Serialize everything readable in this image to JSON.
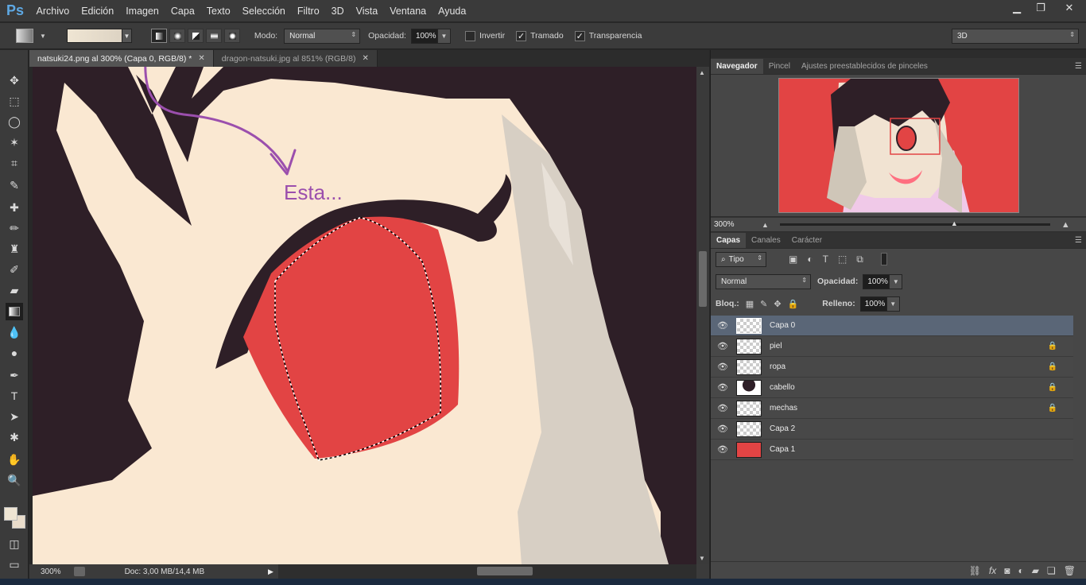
{
  "app": {
    "logo": "Ps"
  },
  "menu": [
    "Archivo",
    "Edición",
    "Imagen",
    "Capa",
    "Texto",
    "Selección",
    "Filtro",
    "3D",
    "Vista",
    "Ventana",
    "Ayuda"
  ],
  "window_controls": {
    "minimize": "▁",
    "restore": "❐",
    "close": "✕"
  },
  "options": {
    "mode_label": "Modo:",
    "mode_value": "Normal",
    "opacity_label": "Opacidad:",
    "opacity_value": "100%",
    "invert_label": "Invertir",
    "invert_checked": false,
    "dither_label": "Tramado",
    "dither_checked": true,
    "transparency_label": "Transparencia",
    "transparency_checked": true,
    "workspace_value": "3D"
  },
  "tabs": [
    {
      "label": "natsuki24.png al 300% (Capa 0, RGB/8) *",
      "close": "✕"
    },
    {
      "label": "dragon-natsuki.jpg al 851% (RGB/8)",
      "close": "✕"
    }
  ],
  "annotation": {
    "text": "Esta...",
    "color": "#9b4fad"
  },
  "status": {
    "zoom": "300%",
    "doc": "Doc: 3,00 MB/14,4 MB"
  },
  "panels": {
    "top_tabs": [
      "Navegador",
      "Pincel",
      "Ajustes preestablecidos de pinceles"
    ],
    "nav_zoom": "300%",
    "layer_tabs": [
      "Capas",
      "Canales",
      "Carácter"
    ],
    "filter_kind": "Tipo",
    "blend_mode": "Normal",
    "opacity_label": "Opacidad:",
    "opacity_value": "100%",
    "lock_label": "Bloq.:",
    "fill_label": "Relleno:",
    "fill_value": "100%"
  },
  "layers": [
    {
      "name": "Capa 0",
      "locked": false,
      "selected": true
    },
    {
      "name": "piel",
      "locked": true,
      "selected": false
    },
    {
      "name": "ropa",
      "locked": true,
      "selected": false
    },
    {
      "name": "cabello",
      "locked": true,
      "selected": false
    },
    {
      "name": "mechas",
      "locked": true,
      "selected": false
    },
    {
      "name": "Capa 2",
      "locked": false,
      "selected": false
    },
    {
      "name": "Capa 1",
      "locked": false,
      "selected": false
    }
  ],
  "colors": {
    "accent_selected": "#5a6677",
    "eye_red": "#e24444",
    "skin": "#fae8d2",
    "hair": "#2e1f27"
  }
}
